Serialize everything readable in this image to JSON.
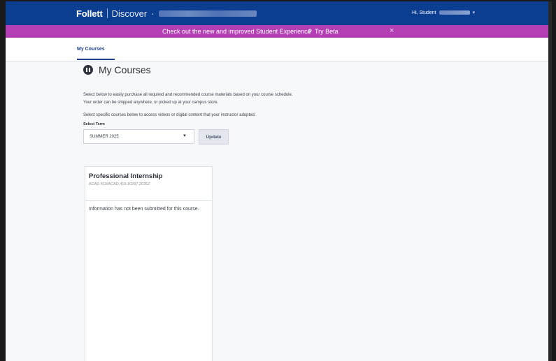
{
  "header": {
    "brand_main": "Follett",
    "brand_sub": "Discover",
    "separator_dot": "·",
    "greeting": "Hi, Student",
    "user_menu_icon": "chevron-down-icon"
  },
  "banner": {
    "message": "Check out the new and improved Student Experience",
    "cta_label": "Try Beta",
    "cta_icon": "rocket-icon",
    "close_glyph": "×",
    "background": "#b43fb5"
  },
  "tabs": [
    {
      "label": "My Courses",
      "active": true
    }
  ],
  "page": {
    "title": "My Courses",
    "title_icon": "book-circle-icon",
    "intro_line1": "Select below to easily purchase all required and recommended course materials based on your course schedule.",
    "intro_line2": "Your order can be shipped anywhere, or picked up at your campus store.",
    "select_note": "Select specific courses below to access videos or digital content that your instructor adopted.",
    "select_label": "Select Term",
    "term_value": "SUMMER 2025",
    "update_label": "Update"
  },
  "course": {
    "name": "Professional Internship",
    "code": "ACAD.419/ACAD.419.10297.20252",
    "info": "Information has not been submitted for this course."
  },
  "colors": {
    "header_bg": "#0b3d91",
    "accent": "#1c3f86"
  }
}
